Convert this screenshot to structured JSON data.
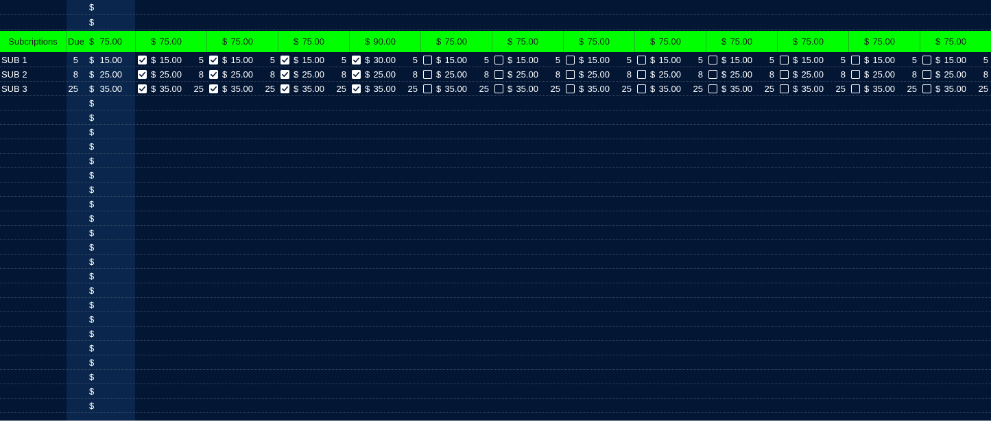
{
  "sheet": {
    "header": {
      "label": "Subcriptions",
      "due_label": "Due",
      "currency": "$",
      "due_total": "75.00",
      "period_totals": [
        "75.00",
        "75.00",
        "75.00",
        "90.00",
        "75.00",
        "75.00",
        "75.00",
        "75.00",
        "75.00",
        "75.00",
        "75.00",
        "75.00"
      ]
    },
    "top_rows": [
      {
        "currency": "$"
      },
      {
        "currency": "$"
      }
    ],
    "subscriptions": [
      {
        "name": "SUB 1",
        "due_day": "5",
        "currency": "$",
        "amount": "15.00",
        "periods": [
          {
            "checked": true,
            "amount": "15.00",
            "due_day": "5"
          },
          {
            "checked": true,
            "amount": "15.00",
            "due_day": "5"
          },
          {
            "checked": true,
            "amount": "15.00",
            "due_day": "5"
          },
          {
            "checked": true,
            "amount": "30.00",
            "due_day": "5"
          },
          {
            "checked": false,
            "amount": "15.00",
            "due_day": "5"
          },
          {
            "checked": false,
            "amount": "15.00",
            "due_day": "5"
          },
          {
            "checked": false,
            "amount": "15.00",
            "due_day": "5"
          },
          {
            "checked": false,
            "amount": "15.00",
            "due_day": "5"
          },
          {
            "checked": false,
            "amount": "15.00",
            "due_day": "5"
          },
          {
            "checked": false,
            "amount": "15.00",
            "due_day": "5"
          },
          {
            "checked": false,
            "amount": "15.00",
            "due_day": "5"
          },
          {
            "checked": false,
            "amount": "15.00",
            "due_day": "5"
          }
        ]
      },
      {
        "name": "SUB 2",
        "due_day": "8",
        "currency": "$",
        "amount": "25.00",
        "periods": [
          {
            "checked": true,
            "amount": "25.00",
            "due_day": "8"
          },
          {
            "checked": true,
            "amount": "25.00",
            "due_day": "8"
          },
          {
            "checked": true,
            "amount": "25.00",
            "due_day": "8"
          },
          {
            "checked": true,
            "amount": "25.00",
            "due_day": "8"
          },
          {
            "checked": false,
            "amount": "25.00",
            "due_day": "8"
          },
          {
            "checked": false,
            "amount": "25.00",
            "due_day": "8"
          },
          {
            "checked": false,
            "amount": "25.00",
            "due_day": "8"
          },
          {
            "checked": false,
            "amount": "25.00",
            "due_day": "8"
          },
          {
            "checked": false,
            "amount": "25.00",
            "due_day": "8"
          },
          {
            "checked": false,
            "amount": "25.00",
            "due_day": "8"
          },
          {
            "checked": false,
            "amount": "25.00",
            "due_day": "8"
          },
          {
            "checked": false,
            "amount": "25.00",
            "due_day": "8"
          }
        ]
      },
      {
        "name": "SUB 3",
        "due_day": "25",
        "currency": "$",
        "amount": "35.00",
        "periods": [
          {
            "checked": true,
            "amount": "35.00",
            "due_day": "25"
          },
          {
            "checked": true,
            "amount": "35.00",
            "due_day": "25"
          },
          {
            "checked": true,
            "amount": "35.00",
            "due_day": "25"
          },
          {
            "checked": true,
            "amount": "35.00",
            "due_day": "25"
          },
          {
            "checked": false,
            "amount": "35.00",
            "due_day": "25"
          },
          {
            "checked": false,
            "amount": "35.00",
            "due_day": "25"
          },
          {
            "checked": false,
            "amount": "35.00",
            "due_day": "25"
          },
          {
            "checked": false,
            "amount": "35.00",
            "due_day": "25"
          },
          {
            "checked": false,
            "amount": "35.00",
            "due_day": "25"
          },
          {
            "checked": false,
            "amount": "35.00",
            "due_day": "25"
          },
          {
            "checked": false,
            "amount": "35.00",
            "due_day": "25"
          },
          {
            "checked": false,
            "amount": "35.00",
            "due_day": "25"
          }
        ]
      }
    ],
    "empty_rows": [
      {
        "currency": "$"
      },
      {
        "currency": "$"
      },
      {
        "currency": "$"
      },
      {
        "currency": "$"
      },
      {
        "currency": "$"
      },
      {
        "currency": "$"
      },
      {
        "currency": "$"
      },
      {
        "currency": "$"
      },
      {
        "currency": "$"
      },
      {
        "currency": "$"
      },
      {
        "currency": "$"
      },
      {
        "currency": "$"
      },
      {
        "currency": "$"
      },
      {
        "currency": "$"
      },
      {
        "currency": "$"
      },
      {
        "currency": "$"
      },
      {
        "currency": "$"
      },
      {
        "currency": "$"
      },
      {
        "currency": "$"
      },
      {
        "currency": "$"
      },
      {
        "currency": "$"
      },
      {
        "currency": "$"
      }
    ],
    "colors": {
      "background": "#031634",
      "due_column": "#0a264c",
      "header": "#00ff00",
      "grid": "#3a4a63"
    }
  }
}
